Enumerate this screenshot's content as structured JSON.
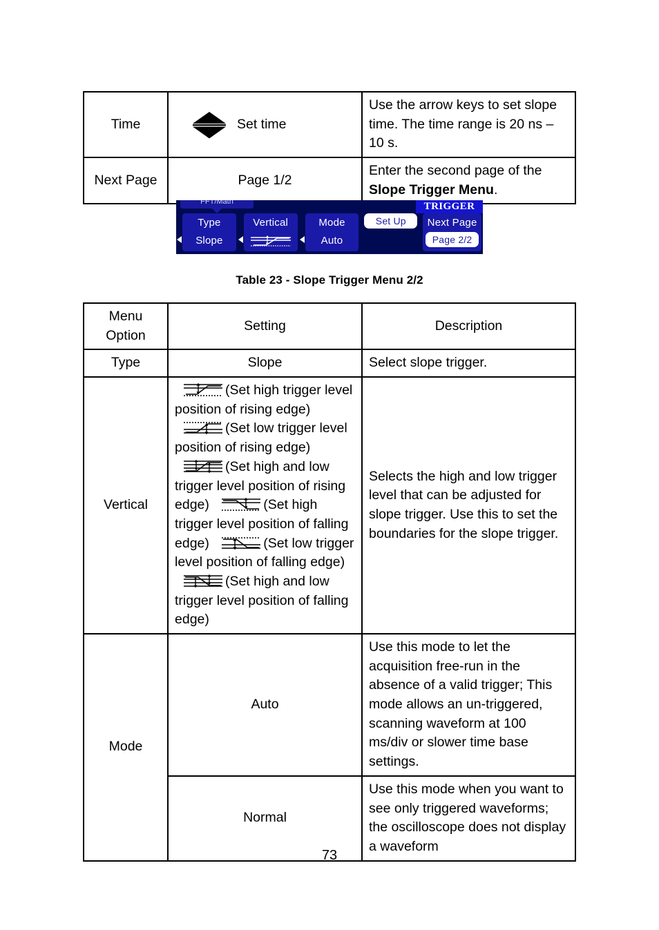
{
  "document": {
    "page_number": "73",
    "table_caption": "Table 23 - Slope Trigger Menu 2/2"
  },
  "top_table": {
    "rows": [
      {
        "option": "Time",
        "setting_icon": "up-down-arrows-icon",
        "setting": "Set time",
        "description": "Use the arrow keys to set slope time. The time range is 20 ns – 10 s."
      },
      {
        "option": "Next Page",
        "setting": "Page 1/2",
        "description_prefix": "Enter the second page of the ",
        "description_bold": "Slope Trigger Menu",
        "description_suffix": "."
      }
    ]
  },
  "scope_screenshot": {
    "tab_fragment": "FFT/Math",
    "trigger_badge": "TRIGGER",
    "columns": [
      {
        "label": "Type",
        "value": "Slope",
        "has_arrow": true
      },
      {
        "label": "Vertical",
        "value": "",
        "icon": "slope-high-rising-icon",
        "has_arrow": true
      },
      {
        "label": "Mode",
        "value": "Auto",
        "has_arrow": true
      },
      {
        "label": "",
        "value": "Set Up",
        "chip": true,
        "has_arrow": false
      },
      {
        "label": "Next Page",
        "value": "Page 2/2",
        "chip": true,
        "has_arrow": false
      }
    ]
  },
  "main_table": {
    "headers": {
      "option": "Menu Option",
      "option_line1": "Menu",
      "option_line2": "Option",
      "setting": "Setting",
      "description": "Description"
    },
    "rows": [
      {
        "option": "Type",
        "setting": "Slope",
        "description": "Select slope trigger."
      },
      {
        "option": "Vertical",
        "setting_items": [
          {
            "icon": "slope-high-level-rising-edge-icon",
            "text": "(Set high trigger level position of rising edge)"
          },
          {
            "icon": "slope-low-level-rising-edge-icon",
            "text": "(Set low trigger level position of rising edge)"
          },
          {
            "icon": "slope-high-low-level-rising-edge-icon",
            "text": "(Set high and low trigger level position of rising edge)"
          },
          {
            "icon": "slope-high-level-falling-edge-icon",
            "text": "(Set high trigger level position of falling edge)"
          },
          {
            "icon": "slope-low-level-falling-edge-icon",
            "text": "(Set low trigger level position of falling edge)"
          },
          {
            "icon": "slope-high-low-level-falling-edge-icon",
            "text": "(Set high and low trigger level position of falling edge)"
          }
        ],
        "description": "Selects the high and low trigger level that can be adjusted for slope trigger.  Use this to set the boundaries for the slope trigger."
      },
      {
        "option": "Mode",
        "setting": "Auto",
        "description": "Use this mode to let the acquisition free-run in the absence of a valid trigger; This mode allows an un-triggered, scanning waveform at 100 ms/div or slower time base settings."
      },
      {
        "option": "",
        "setting": "Normal",
        "description": "Use this mode when you want to see only triggered waveforms; the oscilloscope does not display a waveform"
      }
    ]
  },
  "colors": {
    "scope_background": "#000a52",
    "scope_menu_box": "#1a1aa8",
    "scope_trigger_badge": "#1414d2",
    "scope_text": "#ffffff",
    "table_border": "#000000",
    "page_background": "#ffffff"
  }
}
